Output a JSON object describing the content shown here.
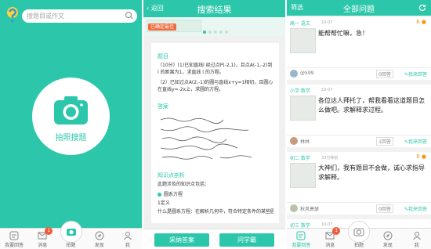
{
  "screen1": {
    "search_placeholder": "搜题目或作文",
    "camera_label": "拍照搜题",
    "tabs": [
      {
        "label": "我要回答",
        "icon": "answer-icon"
      },
      {
        "label": "消息",
        "icon": "message-icon",
        "badge": "1"
      },
      {
        "label": "拍题",
        "icon": "camera-icon"
      },
      {
        "label": "发现",
        "icon": "compass-icon"
      },
      {
        "label": "我",
        "icon": "user-icon"
      }
    ]
  },
  "screen2": {
    "back_label": "返回",
    "title": "搜索结果",
    "banner_tag": "已确定最佳",
    "sections": {
      "question_title": "题目",
      "question_text_1": "（10分）(1)已知直线l 经过点P(-2,1)，且点A(-1,-2)到 l 的距离为1，求直线 l 的方程。",
      "question_text_2": "（2）已知过点A(2,-1)的圆与直线x+y=1相切，且圆心在直线y=-2x上，求圆的方程。",
      "answer_title": "答案",
      "analysis_title": "知识点剖析",
      "analysis_intro": "此题涉及的知识点包括：",
      "analysis_bullet": "圆系方程",
      "analysis_def_title": "1定义",
      "analysis_def_text": "什么是圆系方程：在解析几何中，符合特定条件的某些圆构"
    },
    "buttons": {
      "accept": "采纳答案",
      "ask": "问学霸"
    }
  },
  "screen3": {
    "filter_label": "筛选",
    "title": "全部问题",
    "questions": [
      {
        "subject": "高一 语文",
        "time": "10-07",
        "coins": "6",
        "text": "能帮帮忙嘛，急！",
        "user": "@599",
        "count": "0回答",
        "action": "我来回答"
      },
      {
        "subject": "小学 数学",
        "time": "10-07",
        "coins": "",
        "text": "各位达人拜托了，帮我看看这道题目怎么做吧。求解释求过程。",
        "user": "林林",
        "count": "1回答",
        "action": "我来回答"
      },
      {
        "subject": "初二 数学",
        "time": "33分钟前",
        "coins": "8",
        "text": "大神们，我有题目不会做，诚心求指导求解释。",
        "user": "秋风萧瑟",
        "count": "0回答",
        "action": "我来回答"
      },
      {
        "subject": "初三 数学",
        "time": "10-07",
        "coins": "",
        "text": "",
        "user": "",
        "count": "",
        "action": ""
      }
    ],
    "tabs": [
      {
        "label": "我要回答",
        "icon": "answer-icon"
      },
      {
        "label": "消息",
        "icon": "message-icon",
        "badge": "1"
      },
      {
        "label": "拍题",
        "icon": "camera-icon"
      },
      {
        "label": "发现",
        "icon": "compass-icon"
      },
      {
        "label": "我",
        "icon": "user-icon"
      }
    ]
  },
  "colors": {
    "accent": "#2cc7aa",
    "badge": "#f25b3a",
    "coin": "#f29a1c"
  }
}
